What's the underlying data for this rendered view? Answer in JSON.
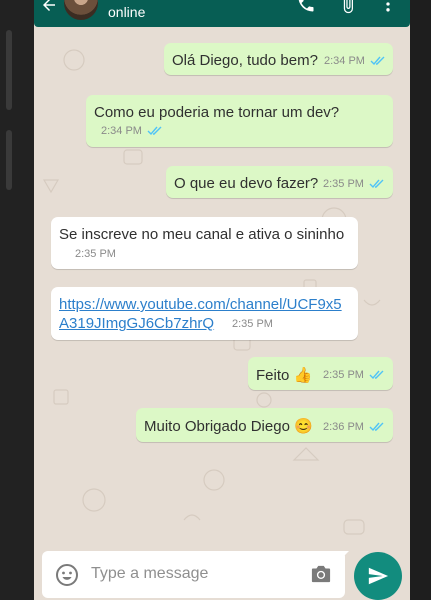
{
  "header": {
    "status": "online"
  },
  "messages": [
    {
      "dir": "out",
      "text": "Olá Diego, tudo bem?",
      "time": "2:34 PM"
    },
    {
      "dir": "out",
      "text": "Como eu poderia me tornar um dev?",
      "time": "2:34 PM"
    },
    {
      "dir": "out",
      "text": "O que eu devo fazer?",
      "time": "2:35 PM"
    },
    {
      "dir": "in",
      "text": "Se inscreve no meu canal e ativa o sininho",
      "time": "2:35 PM"
    },
    {
      "dir": "in",
      "link_line1": "https://www.youtube.com/channel/UCF9x5",
      "link_line2": "A319JImgGJ6Cb7zhrQ",
      "time": "2:35 PM"
    },
    {
      "dir": "out",
      "text": "Feito 👍",
      "time": "2:35 PM"
    },
    {
      "dir": "out",
      "text": "Muito Obrigado Diego 😊",
      "time": "2:36 PM"
    }
  ],
  "composer": {
    "placeholder": "Type a message"
  },
  "colors": {
    "header": "#075e54",
    "outgoing": "#dcf8c6",
    "incoming": "#ffffff",
    "send": "#128c7e",
    "tick": "#4fc3f7"
  },
  "icons": [
    "back-arrow-icon",
    "phone-icon",
    "paperclip-icon",
    "more-vert-icon",
    "emoji-icon",
    "camera-icon",
    "send-icon",
    "double-check-icon"
  ]
}
